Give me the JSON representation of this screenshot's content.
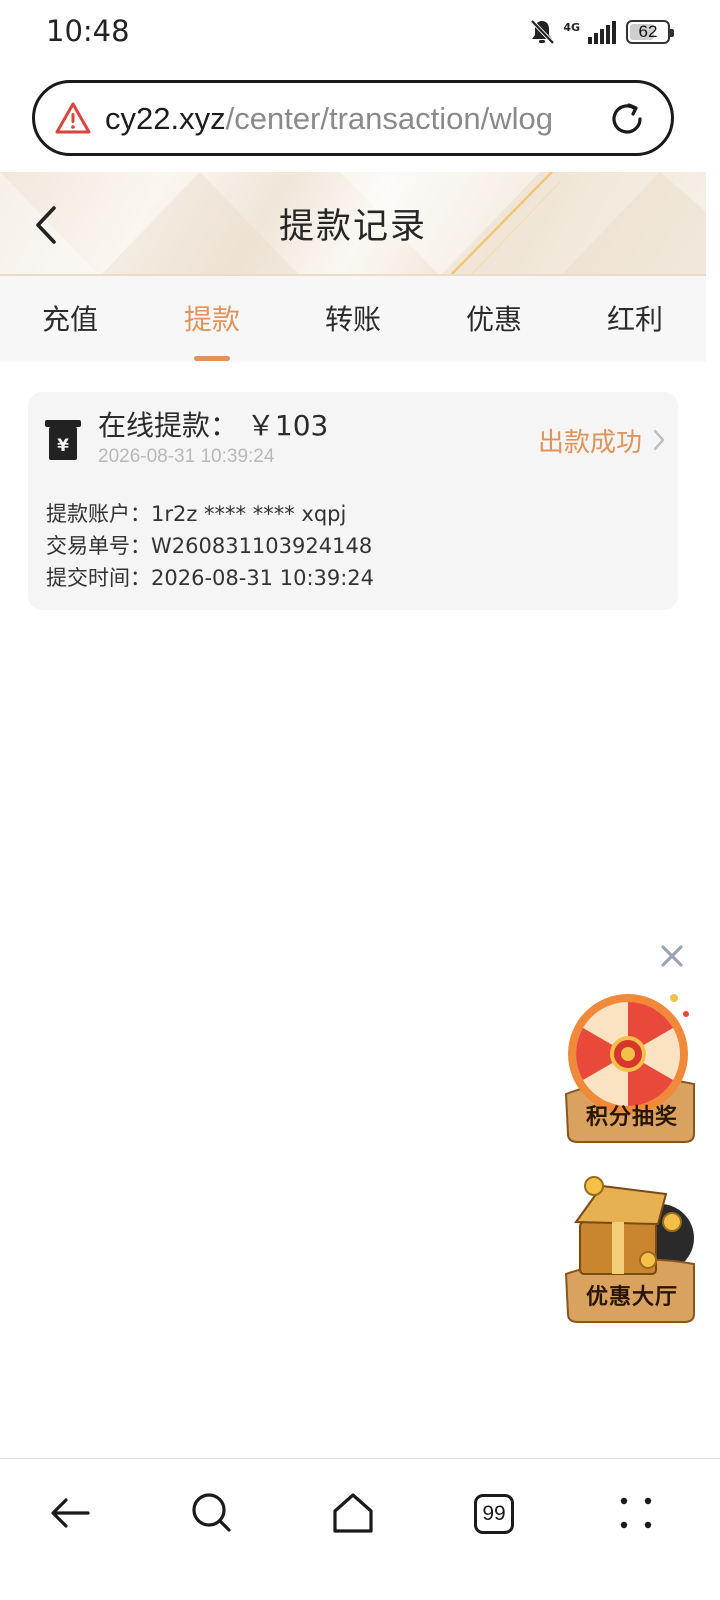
{
  "status_bar": {
    "time": "10:48",
    "network": "4G",
    "battery": "62",
    "battery_level": 0.62,
    "icons": [
      "bell-muted-icon",
      "signal-icon",
      "battery-icon"
    ]
  },
  "browser": {
    "url_host": "cy22.xyz",
    "url_path": "/center/transaction/wlog",
    "security_icon": "warning-triangle-icon",
    "tab_count": "99"
  },
  "header": {
    "title": "提款记录",
    "back_icon": "chevron-left-icon"
  },
  "tabs": [
    {
      "label": "充值",
      "active": false
    },
    {
      "label": "提款",
      "active": true
    },
    {
      "label": "转账",
      "active": false
    },
    {
      "label": "优惠",
      "active": false
    },
    {
      "label": "红利",
      "active": false
    }
  ],
  "record": {
    "title": "在线提款： ￥103",
    "time": "2026-08-31 10:39:24",
    "status": "出款成功",
    "rows": [
      {
        "label": "提款账户：",
        "value": "1r2z **** **** xqpj"
      },
      {
        "label": "交易单号：",
        "value": "W260831103924148"
      },
      {
        "label": "提交时间：",
        "value": "2026-08-31 10:39:24"
      }
    ]
  },
  "promos": [
    {
      "label": "积分抽奖",
      "icon": "lucky-wheel-icon"
    },
    {
      "label": "优惠大厅",
      "icon": "treasure-chest-icon"
    }
  ],
  "colors": {
    "accent": "#e0935a",
    "card_bg": "#f5f5f5",
    "tab_bar_bg": "#f7f7f7",
    "warning": "#d9443b"
  }
}
